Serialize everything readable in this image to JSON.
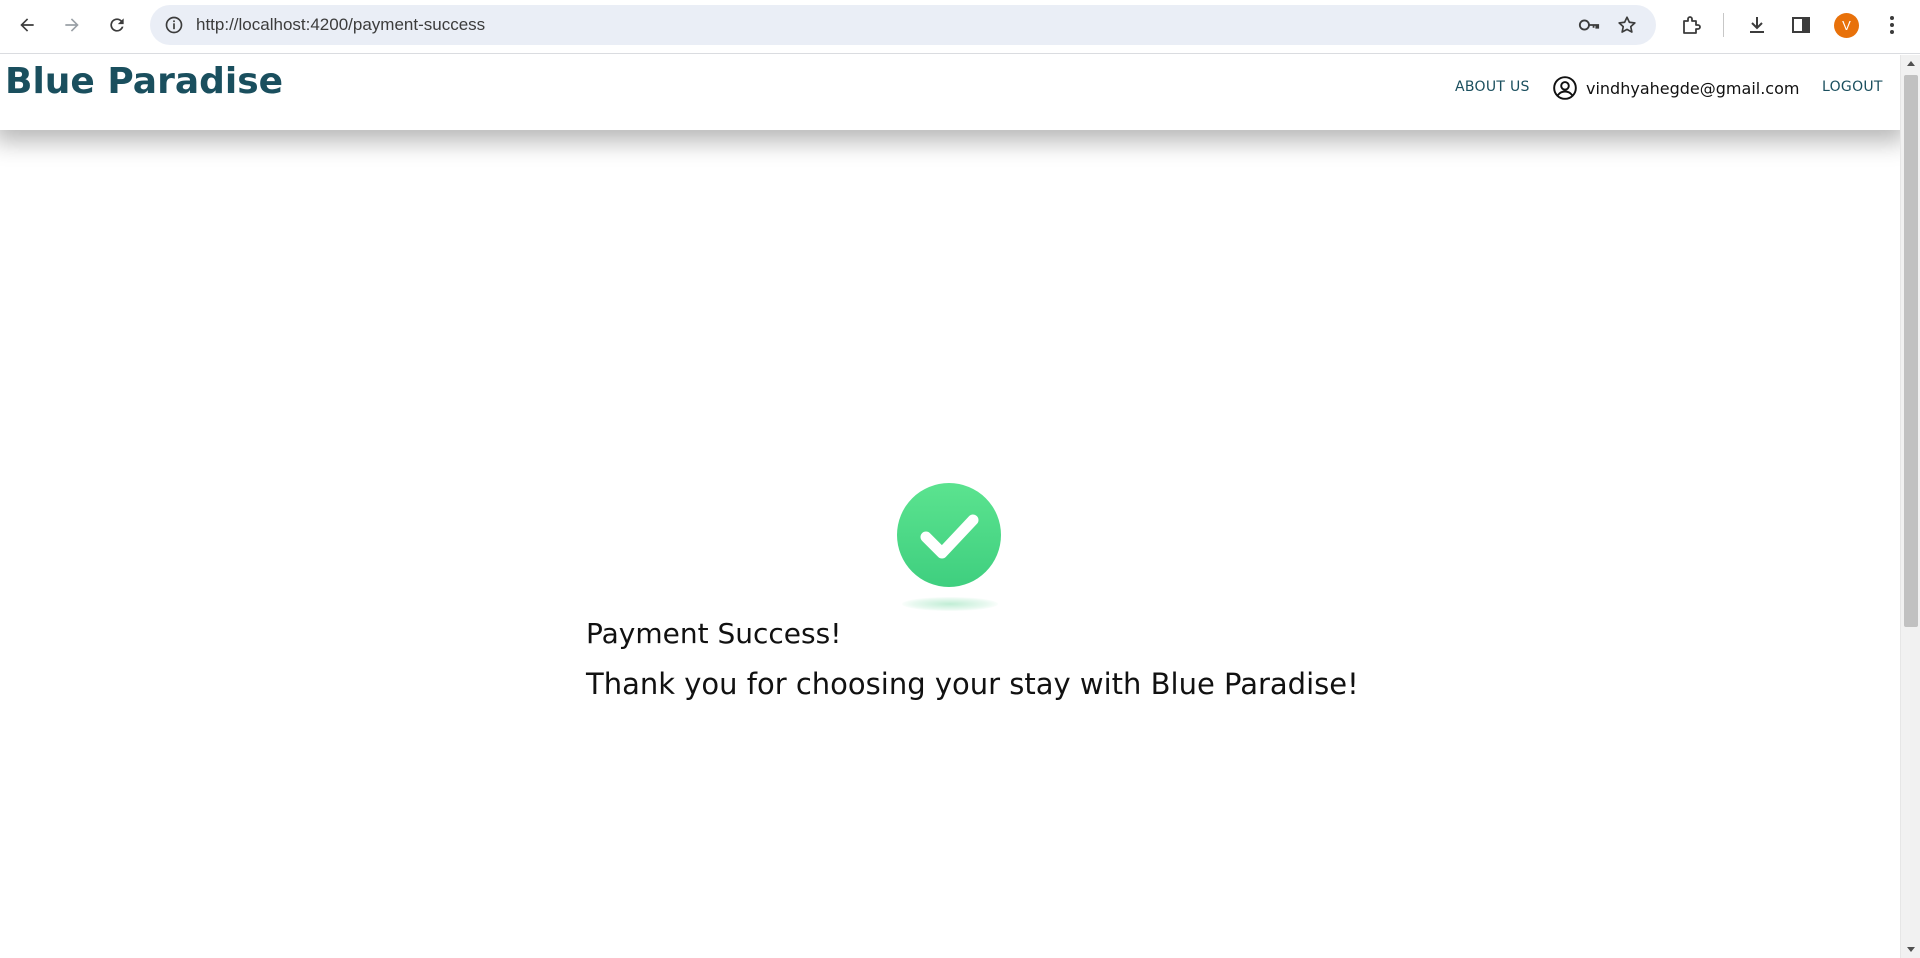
{
  "browser": {
    "url": "http://localhost:4200/payment-success",
    "profile_initial": "V"
  },
  "header": {
    "brand": "Blue Paradise",
    "about_label": "ABOUT US",
    "user_email": "vindhyahegde@gmail.com",
    "logout_label": "LOGOUT"
  },
  "content": {
    "title": "Payment Success!",
    "message": "Thank you for choosing your stay with Blue Paradise!"
  },
  "colors": {
    "brand": "#1a4f5e",
    "success_green": "#4cd98a"
  }
}
